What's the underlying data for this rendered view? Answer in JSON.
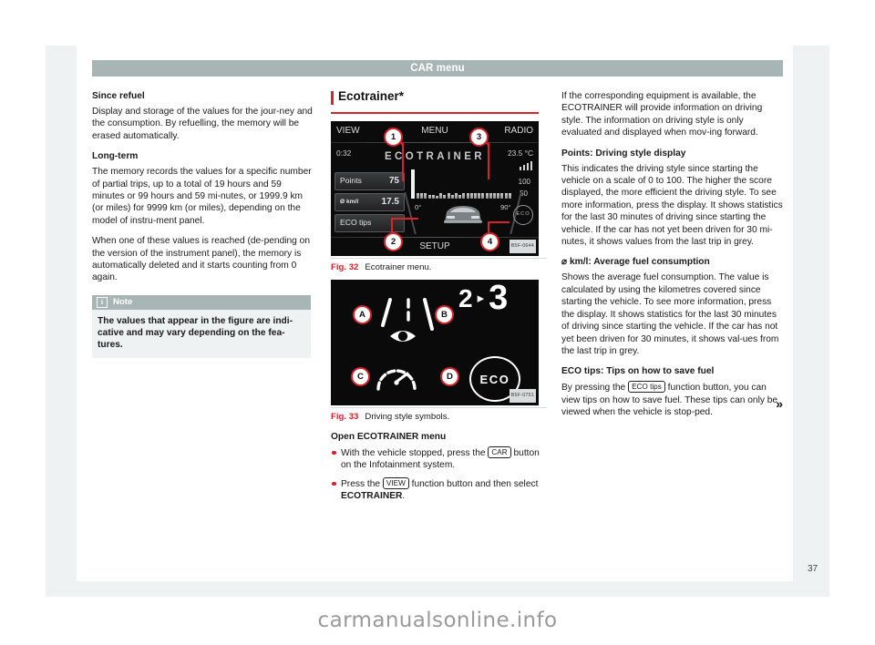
{
  "header": {
    "title": "CAR menu"
  },
  "page_number": "37",
  "watermark": "carmanualsonline.info",
  "continuation_arrow": "»",
  "left_column": {
    "section1_heading": "Since refuel",
    "section1_body": "Display and storage of the values for the jour-ney and the consumption. By refuelling, the memory will be erased automatically.",
    "section2_heading": "Long-term",
    "section2_body": "The memory records the values for a specific number of partial trips, up to a total of 19 hours and 59 minutes or 99 hours and 59 mi-nutes, or 1999.9 km (or miles) for 9999 km (or miles), depending on the model of instru-ment panel.",
    "section2_body2": "When one of these values is reached (de-pending on the version of the instrument panel), the memory is automatically deleted and it starts counting from 0 again.",
    "note": {
      "icon": "info-icon",
      "label": "Note",
      "text": "The values that appear in the figure are indi-cative and may vary depending on the fea-tures."
    }
  },
  "center_column": {
    "heading": "Ecotrainer*",
    "fig32": {
      "number": "Fig. 32",
      "caption": "Ecotrainer menu.",
      "code": "B5F-0644",
      "screen": {
        "tab_left": "VIEW",
        "tab_mid": "MENU",
        "tab_right": "RADIO",
        "clock": "0:32",
        "temperature": "23.5 °C",
        "title": "ECOTRAINER",
        "scale_high": "100",
        "scale_low": "50",
        "axis_left": "0°",
        "axis_right": "90°",
        "bottom_tab": "SETUP",
        "eco_badge": "ECO",
        "tiles": [
          {
            "label": "Points",
            "value": "75"
          },
          {
            "label": "Ø km/l",
            "value": "17.5"
          },
          {
            "label": "ECO tips",
            "value": ""
          }
        ],
        "callouts": [
          "1",
          "2",
          "3",
          "4"
        ]
      }
    },
    "fig33": {
      "number": "Fig. 33",
      "caption": "Driving style symbols.",
      "code": "B5F-0751",
      "symbols": [
        {
          "callout": "A",
          "name": "road-eye-icon"
        },
        {
          "callout": "B",
          "name": "gear-shift-2-to-3-icon",
          "from": "2",
          "arrow": "▸",
          "to": "3"
        },
        {
          "callout": "C",
          "name": "speedometer-icon"
        },
        {
          "callout": "D",
          "name": "eco-circle-icon",
          "text": "ECO"
        }
      ]
    },
    "open_menu_heading": "Open ECOTRAINER menu",
    "steps": [
      {
        "pre": "With the vehicle stopped, press the ",
        "key": "CAR",
        "post": " button on the Infotainment system."
      },
      {
        "pre": "Press the ",
        "key": "VIEW",
        "post": " function button and then select ",
        "bold": "ECOTRAINER",
        "tail": "."
      }
    ]
  },
  "right_column": {
    "intro": "If the corresponding equipment is available, the ECOTRAINER will provide information on driving style. The information on driving style is only evaluated and displayed when mov-ing forward.",
    "s1_heading": "Points: Driving style display",
    "s1_body": "This indicates the driving style since starting the vehicle on a scale of 0 to 100. The higher the score displayed, the more efficient the driving style. To see more information, press the display. It shows statistics for the last 30 minutes of driving since starting the vehicle. If the car has not yet been driven for 30 mi-nutes, it shows values from the last trip in grey.",
    "s2_heading": "⌀ km/l: Average fuel consumption",
    "s2_body": "Shows the average fuel consumption. The value is calculated by using the kilometres covered since starting the vehicle. To see more information, press the display. It shows statistics for the last 30 minutes of driving since starting the vehicle. If the car has not yet been driven for 30 minutes, it shows val-ues from the last trip in grey.",
    "s3_heading": "ECO tips: Tips on how to save fuel",
    "s3_pre": "By pressing the ",
    "s3_key": "ECO tips",
    "s3_post": " function button, you can view tips on how to save fuel. These tips can only be viewed when the vehicle is stop-ped."
  },
  "chart_data": {
    "type": "bar",
    "title": "ECOTRAINER driving style bar graph",
    "xlabel": "",
    "ylabel": "",
    "xlim": [
      0,
      90
    ],
    "ylim": [
      0,
      100
    ],
    "tick_labels_x": [
      "0°",
      "90°"
    ],
    "tick_labels_y": [
      "100",
      "50"
    ],
    "values": [
      20,
      22,
      20,
      16,
      13,
      11,
      22,
      15,
      20,
      13,
      22,
      14,
      20,
      22,
      20,
      21,
      22,
      21,
      22,
      20,
      22,
      21,
      22,
      20,
      22
    ],
    "cursor_value": 26,
    "grid": false,
    "legend": "none"
  }
}
